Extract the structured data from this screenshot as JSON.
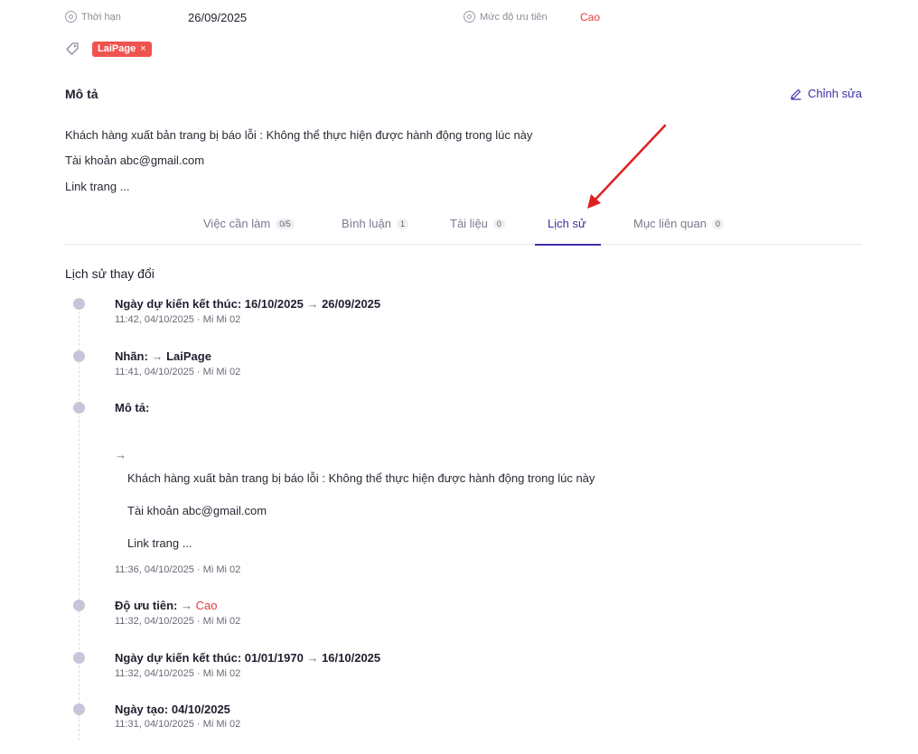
{
  "meta": {
    "deadline_label": "Thời hạn",
    "deadline_value": "26/09/2025",
    "priority_label": "Mức độ ưu tiên",
    "priority_value": "Cao",
    "priority_color": "#e23b3b"
  },
  "tags": [
    {
      "label": "LaiPage",
      "remove": "×",
      "color": "#ef5350"
    }
  ],
  "description": {
    "heading": "Mô tả",
    "edit_label": "Chỉnh sửa",
    "lines": [
      "Khách hàng xuất bản trang bị báo lỗi : Không thể thực hiện được hành động trong lúc này",
      "Tài khoản abc@gmail.com",
      "Link trang ..."
    ]
  },
  "tabs": [
    {
      "label": "Việc cần làm",
      "count": "0/5"
    },
    {
      "label": "Bình luận",
      "count": "1"
    },
    {
      "label": "Tài liệu",
      "count": "0"
    },
    {
      "label": "Lịch sử",
      "count": "",
      "active": true
    },
    {
      "label": "Mục liên quan",
      "count": "0"
    }
  ],
  "history": {
    "title": "Lịch sử thay đổi",
    "entries": [
      {
        "title_prefix": "Ngày dự kiến kết thúc: 16/10/2025 ",
        "arrow": "→",
        "title_suffix": " 26/09/2025",
        "meta": "11:42, 04/10/2025 · Mi Mi 02"
      },
      {
        "title_prefix": "Nhãn:  ",
        "arrow": "→",
        "title_suffix": " LaiPage",
        "meta": "11:41, 04/10/2025 · Mi Mi 02"
      },
      {
        "title_prefix": "Mô tả:",
        "arrow": "→",
        "lines": [
          "Khách hàng xuất bản trang bị báo lỗi : Không thể thực hiện được hành động trong lúc này",
          "Tài khoản abc@gmail.com",
          "Link trang ..."
        ],
        "meta": "11:36, 04/10/2025 · Mi Mi 02"
      },
      {
        "title_prefix": "Độ ưu tiên:  ",
        "arrow": "→",
        "title_suffix": " Cao",
        "meta": "11:32, 04/10/2025 · Mi Mi 02"
      },
      {
        "title_prefix": "Ngày dự kiến kết thúc: 01/01/1970 ",
        "arrow": "→",
        "title_suffix": " 16/10/2025",
        "meta": "11:32, 04/10/2025 · Mi Mi 02"
      },
      {
        "title_prefix": "Ngày tạo: 04/10/2025",
        "meta": "11:31, 04/10/2025 · Mi Mi 02"
      }
    ]
  },
  "accent_color": "#3b2fa8",
  "annotation_arrow_color": "#e02020"
}
